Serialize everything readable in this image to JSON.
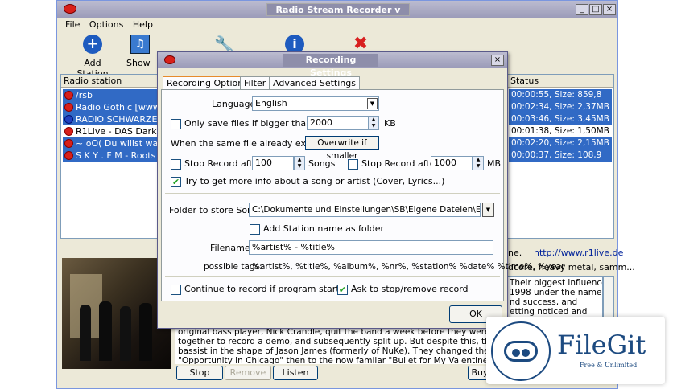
{
  "window": {
    "title": "Radio Stream Recorder v",
    "menu": [
      "File",
      "Options",
      "Help"
    ]
  },
  "toolbar": {
    "add_station": "Add Station",
    "show": "Show R"
  },
  "stations": {
    "header": "Radio station",
    "rows": [
      {
        "name": "/rsb",
        "selected": true,
        "dot": "red"
      },
      {
        "name": "Radio Gothic [www.rad",
        "selected": true,
        "dot": "red"
      },
      {
        "name": "RADIO SCHWARZE V",
        "selected": true,
        "dot": "blue"
      },
      {
        "name": "R1Live - DAS Darkwav",
        "selected": false,
        "dot": "red"
      },
      {
        "name": "~ oO( Du willst was auf",
        "selected": true,
        "dot": "red"
      },
      {
        "name": "S K Y . F M - Roots Re",
        "selected": true,
        "dot": "red"
      }
    ]
  },
  "status": {
    "header": "Status",
    "rows": [
      {
        "text": "00:00:55, Size: 859,8",
        "selected": true
      },
      {
        "text": "00:02:34, Size: 2,37MB",
        "selected": true
      },
      {
        "text": "00:03:46, Size: 3,45MB",
        "selected": true
      },
      {
        "text": "00:01:38, Size: 1,50MB",
        "selected": false
      },
      {
        "text": "00:02:20, Size: 2,15MB",
        "selected": true
      },
      {
        "text": "00:00:37, Size: 108,9",
        "selected": true
      }
    ]
  },
  "info": {
    "site_prefix": "ne.",
    "site": "http://www.r1live.de",
    "genre": "dcore, heavy metal, samm...",
    "bio_right": [
      "Their biggest influences",
      "1998 under the name",
      "nd success, and",
      "etting noticed and",
      "e h"
    ],
    "desc_lines": [
      "original bass player, Nick Crandle, quit the band a week before they were due to record.",
      "together to record a demo, and subsequently split up. But despite this, they did get back",
      "bassist in the shape of Jason James (formerly of NuKe). They changed their name from \"J",
      "\"Opportunity in Chicago\" then to the now familar \"Bullet for My Valentine\". They were"
    ]
  },
  "buttons": {
    "stop": "Stop",
    "remove": "Remove",
    "listen": "Listen",
    "buy": "Buy"
  },
  "dialog": {
    "title": "Recording Settings",
    "tabs": [
      "Recording Options",
      "Filter",
      "Advanced Settings"
    ],
    "language_label": "Language",
    "language_value": "English",
    "only_save_label": "Only save files if bigger than",
    "only_save_value": "2000",
    "only_save_unit": "KB",
    "exists_label": "When the same file already exists do:",
    "exists_button": "Overwrite if smaller",
    "stop_after_label": "Stop Record after",
    "stop_songs_value": "100",
    "songs_unit": "Songs",
    "stop_mb_label": "Stop Record after",
    "stop_mb_value": "1000",
    "mb_unit": "MB",
    "more_info_label": "Try to get more info about a song or artist (Cover, Lyrics...)",
    "folder_label": "Folder to store Songs",
    "folder_value": "C:\\Dokumente und Einstellungen\\SB\\Eigene Dateien\\Eigene M",
    "add_station_folder": "Add Station name as folder",
    "filename_label": "Filename",
    "filename_value": "%artist% - %title%",
    "tags_label": "possible tags:",
    "tags": "%artist%, %title%, %album%, %nr%, %station% %date% %time%, %year",
    "continue_label": "Continue to record if program starts",
    "ask_stop_label": "Ask to stop/remove record",
    "ok": "OK"
  },
  "logo": {
    "name": "FileGit",
    "tagline": "Free & Unlimited"
  },
  "colors": {
    "selection": "#316ac5",
    "title_gradient": "#9a9ab8",
    "logo_blue": "#1c4a80"
  }
}
